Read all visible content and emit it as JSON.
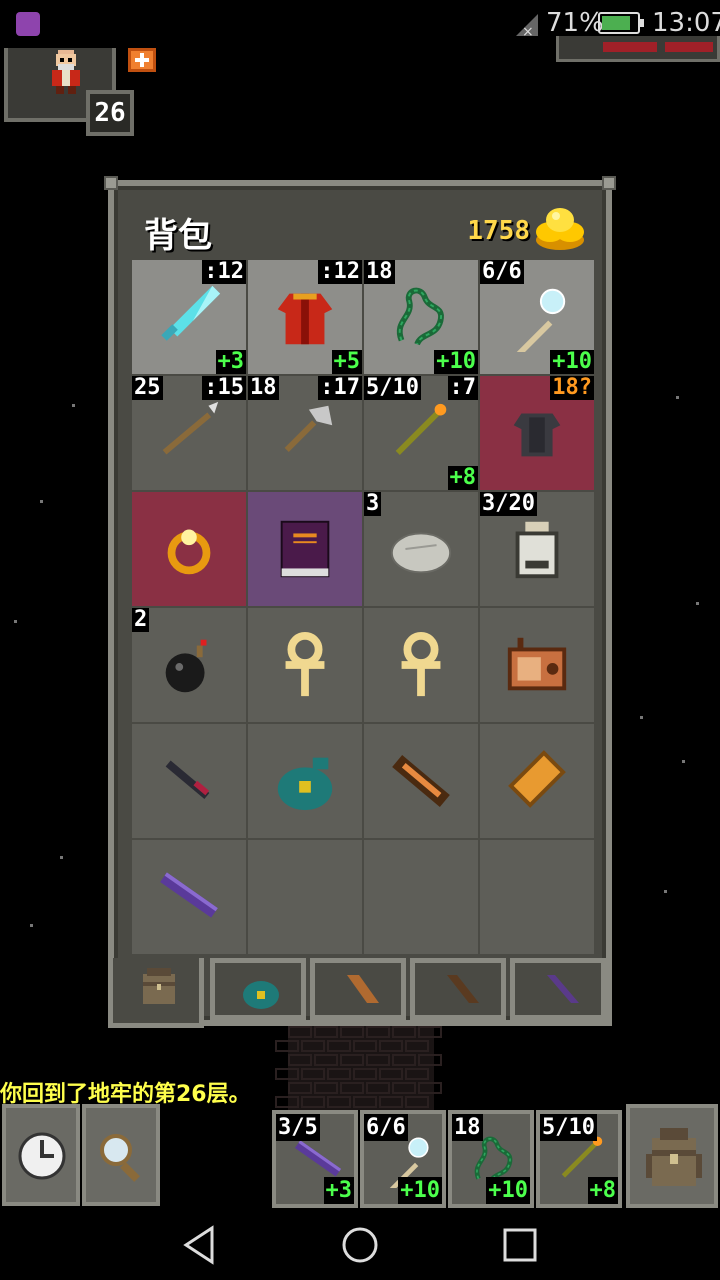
{
  "status_bar": {
    "battery": "71%",
    "time": "13:07",
    "icons": [
      "app-notification-icon",
      "signal-icon",
      "battery-icon"
    ]
  },
  "hero": {
    "level": "26",
    "buff_icon": "health-buff-icon"
  },
  "backpack": {
    "title": "背包",
    "gold": "1758",
    "gold_icon": "gold-pile-icon",
    "slots": [
      {
        "icon": "diamond-sword-icon",
        "state": "equipped",
        "tl": "",
        "tr": ":12",
        "br": "+3"
      },
      {
        "icon": "red-robe-armor-icon",
        "state": "equipped",
        "tl": "",
        "tr": ":12",
        "br": "+5"
      },
      {
        "icon": "green-chain-icon",
        "state": "equipped",
        "tl": "18",
        "tr": "",
        "br": "+10"
      },
      {
        "icon": "magic-wand-icon",
        "state": "equipped",
        "tl": "6/6",
        "tr": "",
        "br": "+10"
      },
      {
        "icon": "spear-icon",
        "state": "normal",
        "tl": "25",
        "tr": ":15",
        "br": ""
      },
      {
        "icon": "throwing-axe-icon",
        "state": "normal",
        "tl": "18",
        "tr": ":17",
        "br": ""
      },
      {
        "icon": "fire-staff-icon",
        "state": "normal",
        "tl": "5/10",
        "tr": ":7",
        "br": "+8"
      },
      {
        "icon": "dark-armor-icon",
        "state": "unknown",
        "tl": "",
        "tr": "18?",
        "br": ""
      },
      {
        "icon": "amber-ring-icon",
        "state": "unknown",
        "tl": "",
        "tr": "",
        "br": ""
      },
      {
        "icon": "purple-tome-icon",
        "state": "arcane",
        "tl": "",
        "tr": "",
        "br": ""
      },
      {
        "icon": "stone-icon",
        "state": "normal",
        "tl": "3",
        "tr": "",
        "br": ""
      },
      {
        "icon": "dew-vial-icon",
        "state": "normal",
        "tl": "3/20",
        "tr": "",
        "br": ""
      },
      {
        "icon": "bomb-icon",
        "state": "normal",
        "tl": "2",
        "tr": "",
        "br": ""
      },
      {
        "icon": "ankh-icon",
        "state": "normal",
        "tl": "",
        "tr": "",
        "br": ""
      },
      {
        "icon": "ankh-icon",
        "state": "normal",
        "tl": "",
        "tr": "",
        "br": ""
      },
      {
        "icon": "radio-icon",
        "state": "normal",
        "tl": "",
        "tr": "",
        "br": ""
      },
      {
        "icon": "dark-dagger-icon",
        "state": "normal",
        "tl": "",
        "tr": "",
        "br": ""
      },
      {
        "icon": "seed-pouch-icon",
        "state": "normal",
        "tl": "",
        "tr": "",
        "br": ""
      },
      {
        "icon": "wand-holster-icon",
        "state": "normal",
        "tl": "",
        "tr": "",
        "br": ""
      },
      {
        "icon": "scroll-holder-icon",
        "state": "normal",
        "tl": "",
        "tr": "",
        "br": ""
      },
      {
        "icon": "purple-wand-icon",
        "state": "normal",
        "tl": "",
        "tr": "",
        "br": ""
      },
      {
        "icon": "",
        "state": "normal",
        "tl": "",
        "tr": "",
        "br": ""
      },
      {
        "icon": "",
        "state": "normal",
        "tl": "",
        "tr": "",
        "br": ""
      },
      {
        "icon": "",
        "state": "normal",
        "tl": "",
        "tr": "",
        "br": ""
      }
    ],
    "tabs": [
      "backpack-tab-icon",
      "seed-pouch-tab-icon",
      "scroll-holder-tab-icon",
      "wand-holster-tab-icon",
      "potion-bandolier-tab-icon"
    ]
  },
  "log": {
    "message": "你回到了地牢的第26层。"
  },
  "toolbar": {
    "wait_icon": "clock-icon",
    "search_icon": "magnifier-icon",
    "quickslots": [
      {
        "icon": "purple-wand-icon",
        "tl": "3/5",
        "br": "+3"
      },
      {
        "icon": "magic-wand-icon",
        "tl": "6/6",
        "br": "+10"
      },
      {
        "icon": "green-chain-icon",
        "tl": "18",
        "br": "+10"
      },
      {
        "icon": "fire-staff-icon",
        "tl": "5/10",
        "br": "+8"
      }
    ],
    "backpack_icon": "backpack-icon"
  },
  "navbar": {
    "icons": [
      "back-icon",
      "home-icon",
      "recents-icon"
    ]
  }
}
